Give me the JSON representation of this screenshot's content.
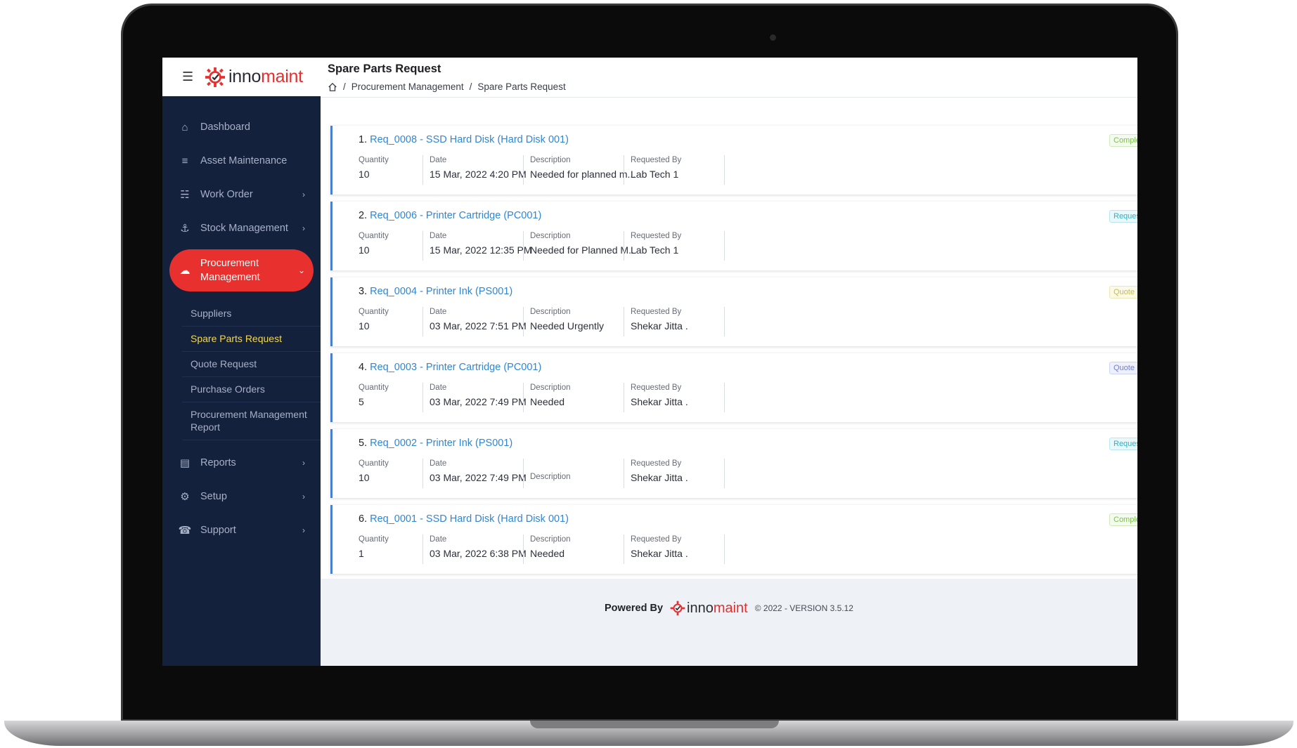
{
  "brand": {
    "name_part1": "inno",
    "name_part2": "maint",
    "accent": "#e8312f",
    "sidebar_bg": "#14213d"
  },
  "sidebar": {
    "items": [
      {
        "label": "Dashboard",
        "icon": "home-icon"
      },
      {
        "label": "Asset Maintenance",
        "icon": "layers-icon"
      },
      {
        "label": "Work Order",
        "icon": "sliders-icon"
      },
      {
        "label": "Stock Management",
        "icon": "anchor-icon"
      },
      {
        "label": "Procurement Management",
        "icon": "cart-icon"
      },
      {
        "label": "Reports",
        "icon": "report-icon"
      },
      {
        "label": "Setup",
        "icon": "gear-icon"
      },
      {
        "label": "Support",
        "icon": "headset-icon"
      }
    ],
    "sub_items": [
      "Suppliers",
      "Spare Parts Request",
      "Quote Request",
      "Purchase Orders",
      "Procurement Management Report"
    ]
  },
  "header": {
    "title": "Spare Parts Request",
    "breadcrumb": [
      "Procurement Management",
      "Spare Parts Request"
    ]
  },
  "columns": {
    "quantity": "Quantity",
    "date": "Date",
    "description": "Description",
    "requested_by": "Requested By"
  },
  "requests": [
    {
      "num": "1.",
      "title": "Req_0008 - SSD Hard Disk (Hard Disk 001)",
      "quantity": "10",
      "date": "15 Mar, 2022 4:20 PM",
      "description": "Needed for planned m...",
      "requested_by": "Lab Tech 1",
      "status": "Complete"
    },
    {
      "num": "2.",
      "title": "Req_0006 - Printer Cartridge (PC001)",
      "quantity": "10",
      "date": "15 Mar, 2022 12:35 PM",
      "description": "Needed for Planned M...",
      "requested_by": "Lab Tech 1",
      "status": "Request"
    },
    {
      "num": "3.",
      "title": "Req_0004 - Printer Ink (PS001)",
      "quantity": "10",
      "date": "03 Mar, 2022 7:51 PM",
      "description": "Needed Urgently",
      "requested_by": "Shekar Jitta .",
      "status": "Quote In"
    },
    {
      "num": "4.",
      "title": "Req_0003 - Printer Cartridge (PC001)",
      "quantity": "5",
      "date": "03 Mar, 2022 7:49 PM",
      "description": "Needed",
      "requested_by": "Shekar Jitta .",
      "status": "Quote R"
    },
    {
      "num": "5.",
      "title": "Req_0002 - Printer Ink (PS001)",
      "quantity": "10",
      "date": "03 Mar, 2022 7:49 PM",
      "description": "",
      "requested_by": "Shekar Jitta .",
      "status": "Request"
    },
    {
      "num": "6.",
      "title": "Req_0001 - SSD Hard Disk (Hard Disk 001)",
      "quantity": "1",
      "date": "03 Mar, 2022 6:38 PM",
      "description": "Needed",
      "requested_by": "Shekar Jitta .",
      "status": "Complete"
    }
  ],
  "footer": {
    "powered_by": "Powered By",
    "version": "© 2022 - VERSION 3.5.12"
  }
}
